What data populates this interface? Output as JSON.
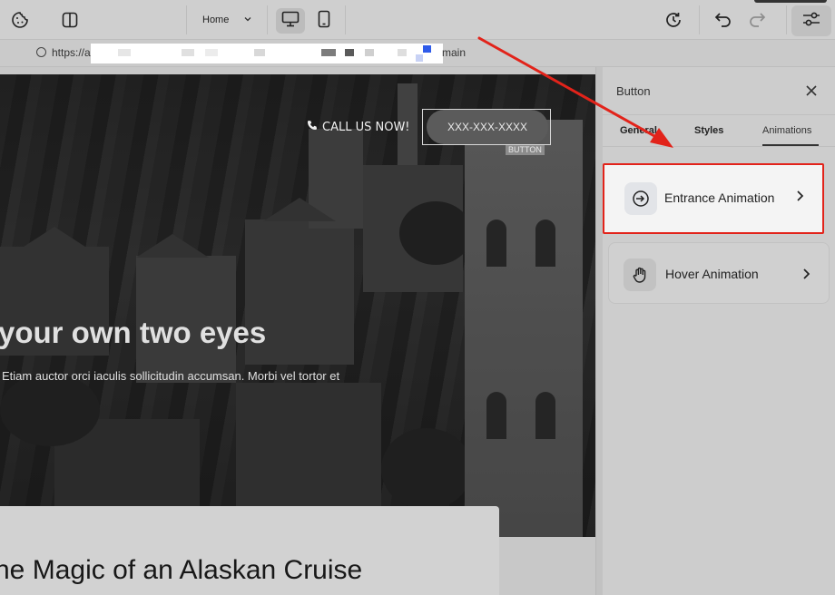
{
  "toolbar": {
    "page_select": "Home",
    "icons": [
      "cookie-icon",
      "panels-icon",
      "chevron-down-icon",
      "desktop-icon",
      "mobile-icon",
      "history-icon",
      "undo-icon",
      "redo-icon",
      "sliders-icon"
    ]
  },
  "urlbar": {
    "prefix": "https://a",
    "suffix": "main"
  },
  "canvas": {
    "call_text": "CALL US NOW!",
    "phone_button": "XXX-XXX-XXXX",
    "button_tag": "BUTTON",
    "hero_title": "your own two eyes",
    "hero_subtitle": "Etiam auctor orci iaculis sollicitudin accumsan. Morbi vel tortor et",
    "card_title": "he Magic of an Alaskan Cruise"
  },
  "panel": {
    "title": "Button",
    "tabs": [
      {
        "label": "General"
      },
      {
        "label": "Styles"
      },
      {
        "label": "Animations",
        "active": true
      }
    ],
    "items": [
      {
        "label": "Entrance Animation",
        "icon": "entrance-icon"
      },
      {
        "label": "Hover Animation",
        "icon": "hand-icon"
      }
    ]
  },
  "colors": {
    "highlight_red": "#e2231a",
    "accent_blue": "#2f5bea"
  }
}
